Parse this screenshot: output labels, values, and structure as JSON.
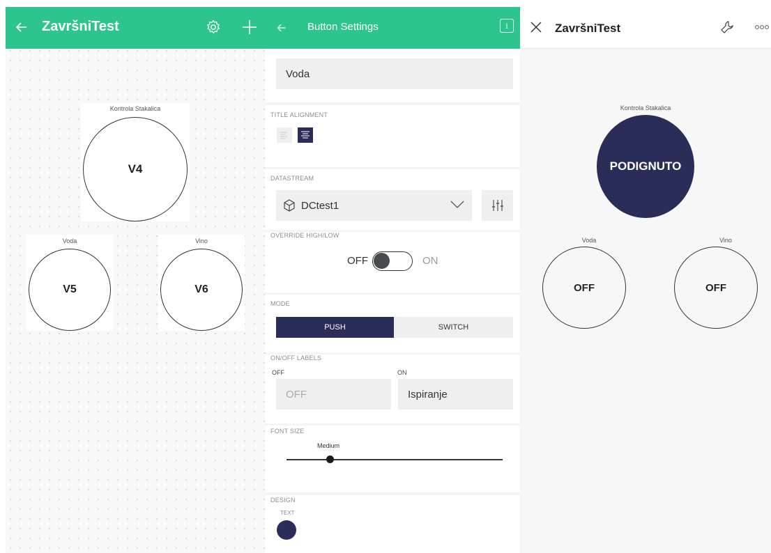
{
  "editor": {
    "title": "ZavršniTest",
    "widgets": [
      {
        "label": "Kontrola Stakalica",
        "pin": "V4"
      },
      {
        "label": "Voda",
        "pin": "V5"
      },
      {
        "label": "Vino",
        "pin": "V6"
      }
    ]
  },
  "settings": {
    "header_title": "Button Settings",
    "name_value": "Voda",
    "title_alignment_label": "TITLE ALIGNMENT",
    "datastream_label": "DATASTREAM",
    "datastream_value": "DCtest1",
    "override_label": "OVERRIDE HIGH/LOW",
    "override_off": "OFF",
    "override_on": "ON",
    "mode_label": "MODE",
    "mode_push": "PUSH",
    "mode_switch": "SWITCH",
    "onoff_label": "ON/OFF LABELS",
    "off_caption": "OFF",
    "on_caption": "ON",
    "off_value": "OFF",
    "on_value": "Ispiranje",
    "font_size_label": "FONT SIZE",
    "font_size_value": "Medium",
    "font_size_level": 0.2,
    "design_label": "DESIGN",
    "design_text_label": "TEXT",
    "design_color": "#2b2d59"
  },
  "live": {
    "title": "ZavršniTest",
    "big_label": "Kontrola Stakalica",
    "big_state": "PODIGNUTO",
    "left_label": "Voda",
    "left_state": "OFF",
    "right_label": "Vino",
    "right_state": "OFF"
  },
  "colors": {
    "accent": "#2ec48d",
    "navy": "#2b2d59"
  }
}
